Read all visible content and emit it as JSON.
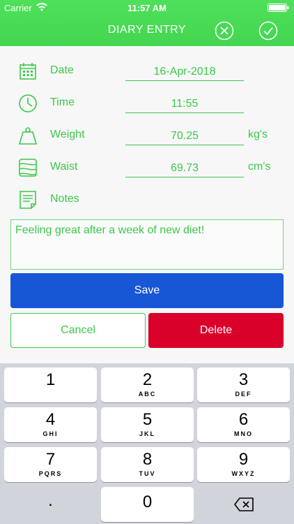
{
  "status_bar": {
    "carrier": "Carrier",
    "time": "11:57 AM"
  },
  "header": {
    "title": "DIARY ENTRY",
    "close_icon": "close-circle-icon",
    "confirm_icon": "check-circle-icon"
  },
  "fields": {
    "date": {
      "label": "Date",
      "value": "16-Apr-2018",
      "icon": "calendar-icon"
    },
    "time": {
      "label": "Time",
      "value": "11:55",
      "icon": "clock-icon"
    },
    "weight": {
      "label": "Weight",
      "value": "70.25",
      "unit": "kg's",
      "icon": "weight-icon"
    },
    "waist": {
      "label": "Waist",
      "value": "69.73",
      "unit": "cm's",
      "icon": "tape-measure-icon"
    },
    "notes": {
      "label": "Notes",
      "value": "Feeling great after a week of new diet!",
      "icon": "notes-icon"
    }
  },
  "buttons": {
    "save": "Save",
    "cancel": "Cancel",
    "delete": "Delete"
  },
  "keypad": {
    "keys": [
      {
        "num": "1",
        "letters": ""
      },
      {
        "num": "2",
        "letters": "ABC"
      },
      {
        "num": "3",
        "letters": "DEF"
      },
      {
        "num": "4",
        "letters": "GHI"
      },
      {
        "num": "5",
        "letters": "JKL"
      },
      {
        "num": "6",
        "letters": "MNO"
      },
      {
        "num": "7",
        "letters": "PQRS"
      },
      {
        "num": "8",
        "letters": "TUV"
      },
      {
        "num": "9",
        "letters": "WXYZ"
      },
      {
        "num": ".",
        "letters": ""
      },
      {
        "num": "0",
        "letters": ""
      }
    ]
  },
  "colors": {
    "accent": "#3bc84a",
    "header": "#44d651",
    "save": "#1757d6",
    "delete": "#d9002a"
  }
}
